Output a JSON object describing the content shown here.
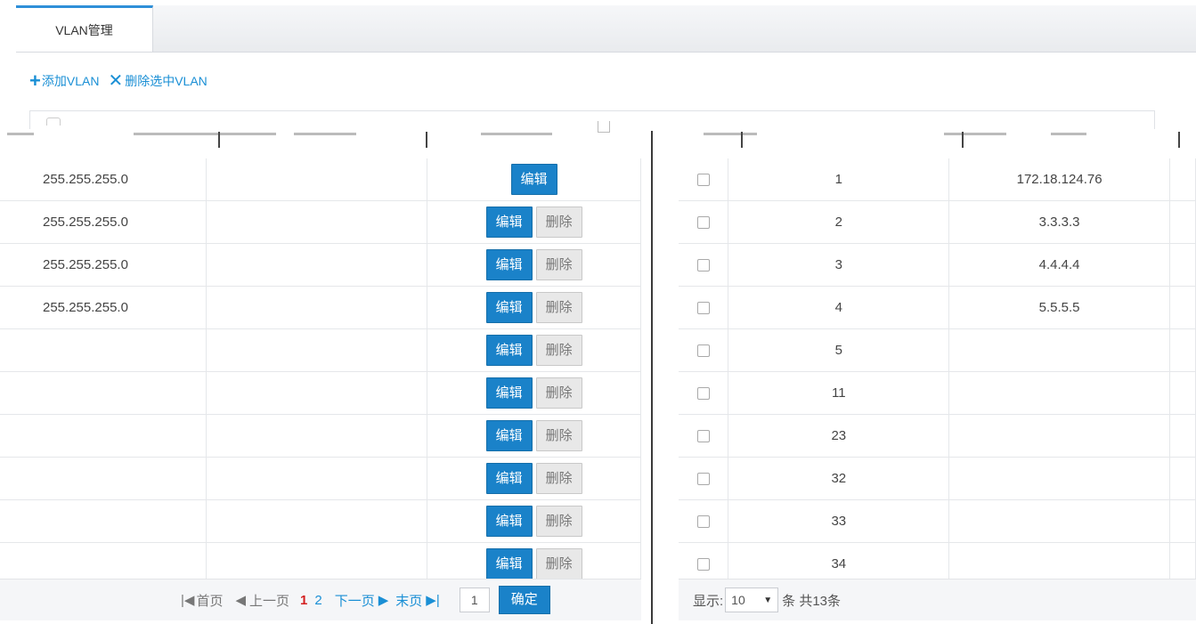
{
  "tab": {
    "label": "VLAN管理"
  },
  "toolbar": {
    "add_icon": "+",
    "add_label": "添加VLAN",
    "delete_icon": "✕",
    "delete_label": "删除选中VLAN"
  },
  "ops": {
    "edit_label": "编辑",
    "delete_label": "删除"
  },
  "left_rows": [
    {
      "mask": "255.255.255.0",
      "deletable": false
    },
    {
      "mask": "255.255.255.0",
      "deletable": true
    },
    {
      "mask": "255.255.255.0",
      "deletable": true
    },
    {
      "mask": "255.255.255.0",
      "deletable": true
    },
    {
      "mask": "",
      "deletable": true
    },
    {
      "mask": "",
      "deletable": true
    },
    {
      "mask": "",
      "deletable": true
    },
    {
      "mask": "",
      "deletable": true
    },
    {
      "mask": "",
      "deletable": true
    },
    {
      "mask": "",
      "deletable": true
    }
  ],
  "right_rows": [
    {
      "id": "1",
      "ip": "172.18.124.76"
    },
    {
      "id": "2",
      "ip": "3.3.3.3"
    },
    {
      "id": "3",
      "ip": "4.4.4.4"
    },
    {
      "id": "4",
      "ip": "5.5.5.5"
    },
    {
      "id": "5",
      "ip": ""
    },
    {
      "id": "11",
      "ip": ""
    },
    {
      "id": "23",
      "ip": ""
    },
    {
      "id": "32",
      "ip": ""
    },
    {
      "id": "33",
      "ip": ""
    },
    {
      "id": "34",
      "ip": ""
    }
  ],
  "pager": {
    "first": "首页",
    "prev": "上一页",
    "page_current": "1",
    "page_next_num": "2",
    "next": "下一页",
    "last": "末页",
    "input_value": "1",
    "go": "确定"
  },
  "footer": {
    "show_label": "显示:",
    "page_size": "10",
    "unit_total": "条 共13条"
  },
  "colors": {
    "accent": "#1a82c9",
    "link": "#1a8fd5",
    "current_page": "#d42020"
  }
}
